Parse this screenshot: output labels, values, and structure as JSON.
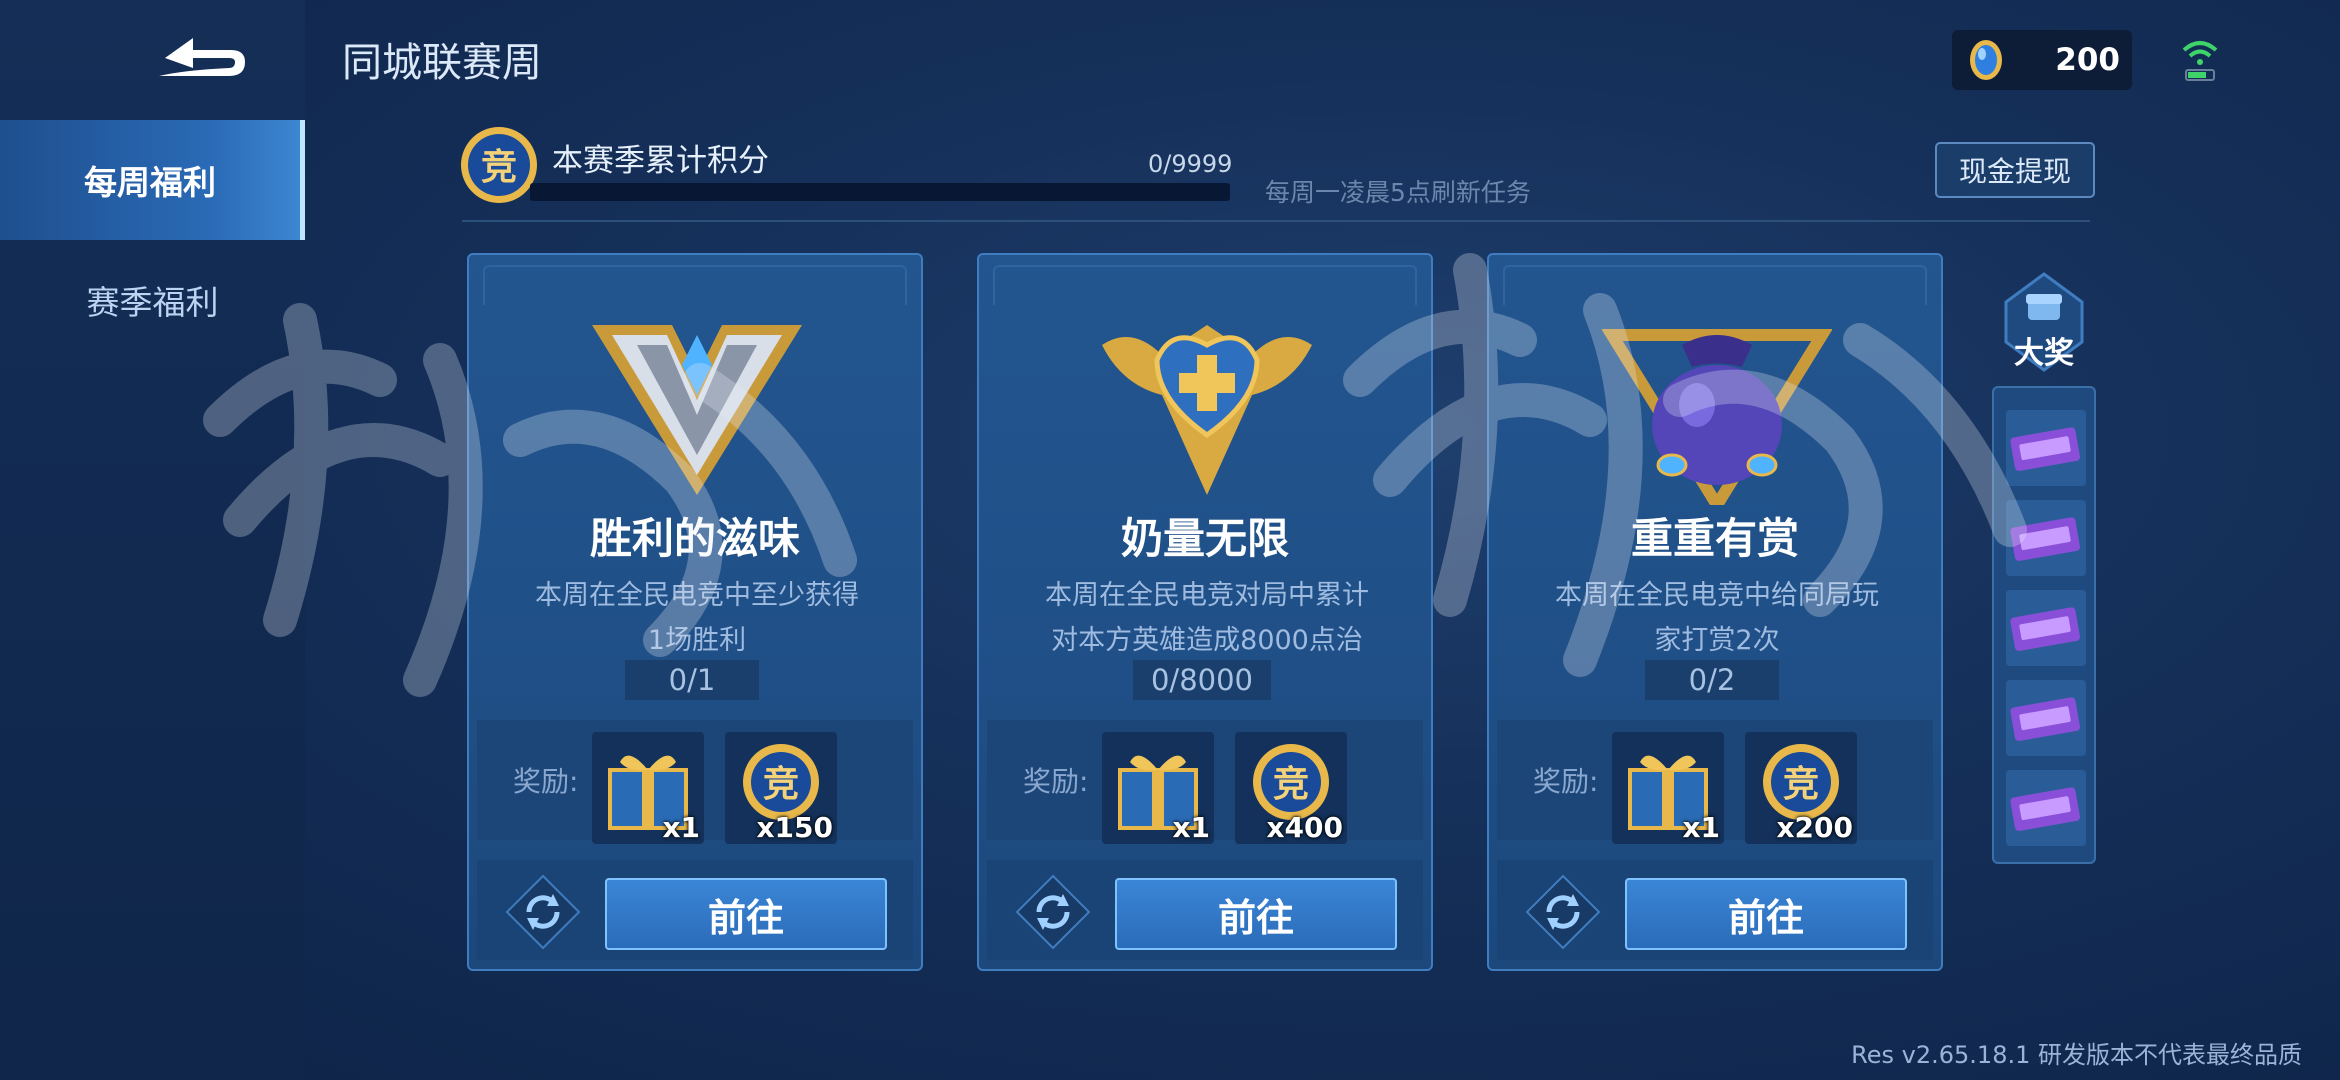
{
  "header": {
    "title": "同城联赛周",
    "currency_value": "200"
  },
  "sidebar": {
    "items": [
      {
        "label": "每周福利"
      },
      {
        "label": "赛季福利"
      }
    ]
  },
  "season": {
    "label": "本赛季累计积分",
    "progress_text": "0/9999",
    "progress_fraction": 0,
    "refresh_note": "每周一凌晨5点刷新任务",
    "cash_button": "现金提现",
    "emblem_char": "竞"
  },
  "cards": [
    {
      "title": "胜利的滋味",
      "desc_line1": "本周在全民电竞中至少获得",
      "desc_line2": "1场胜利",
      "progress": "0/1",
      "reward_label": "奖励:",
      "rewards": [
        {
          "icon": "gift-box-icon",
          "count": "x1"
        },
        {
          "icon": "coin-icon",
          "count": "x150"
        }
      ],
      "go_label": "前往"
    },
    {
      "title": "奶量无限",
      "desc_line1": "本周在全民电竞对局中累计",
      "desc_line2": "对本方英雄造成8000点治",
      "progress": "0/8000",
      "reward_label": "奖励:",
      "rewards": [
        {
          "icon": "gift-box-icon",
          "count": "x1"
        },
        {
          "icon": "coin-icon",
          "count": "x400"
        }
      ],
      "go_label": "前往"
    },
    {
      "title": "重重有赏",
      "desc_line1": "本周在全民电竞中给同局玩",
      "desc_line2": "家打赏2次",
      "progress": "0/2",
      "reward_label": "奖励:",
      "rewards": [
        {
          "icon": "gift-box-icon",
          "count": "x1"
        },
        {
          "icon": "coin-icon",
          "count": "x200"
        }
      ],
      "go_label": "前往"
    }
  ],
  "grand_prize": {
    "label": "大奖",
    "ticket_count": 5
  },
  "footer": {
    "version": "Res v2.65.18.1 研发版本不代表最终品质"
  },
  "colors": {
    "accent_blue": "#3b86d6",
    "gold": "#e8b84a",
    "background": "#15305a"
  }
}
